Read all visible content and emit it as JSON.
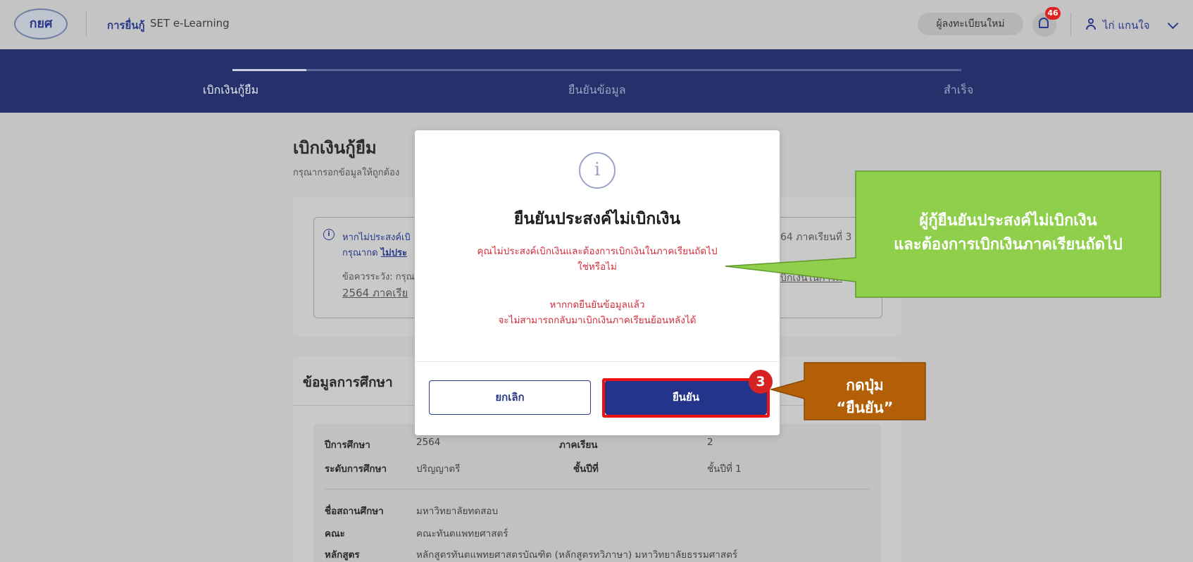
{
  "header": {
    "logo_text": "กยศ",
    "nav": [
      "การยื่นกู้",
      "SET e-Learning"
    ],
    "new_register_label": "ผู้ลงทะเบียนใหม่",
    "notification_count": "46",
    "user_name": "ไก่ แกนใจ"
  },
  "stepper": {
    "steps": [
      "เบิกเงินกู้ยืม",
      "ยืนยันข้อมูล",
      "สำเร็จ"
    ],
    "active_index": 0
  },
  "page": {
    "title": "เบิกเงินกู้ยืม",
    "subtitle": "กรุณากรอกข้อมูลให้ถูกต้อง",
    "notice": {
      "line1": "หากไม่ประสงค์เบิ",
      "line2_prefix": "กรุณากด",
      "line2_link": "ไม่ประ",
      "line3": "ข้อควรระวัง: กรุณ",
      "line4": "2564 ภาคเรีย",
      "right1": "64 ภาคเรียนที่ 3",
      "right2": "บิกเงินในการศึ"
    },
    "education": {
      "title": "ข้อมูลการศึกษา",
      "year_label": "ปีการศึกษา",
      "year_value": "2564",
      "term_label": "ภาคเรียน",
      "term_value": "2",
      "level_label": "ระดับการศึกษา",
      "level_value": "ปริญญาตรี",
      "grade_label": "ชั้นปีที่",
      "grade_value": "ชั้นปีที่ 1",
      "school_label": "ชื่อสถานศึกษา",
      "school_value": "มหาวิทยาลัยทดสอบ",
      "faculty_label": "คณะ",
      "faculty_value": "คณะทันตแพทยศาสตร์",
      "program_label": "หลักสูตร",
      "program_value": "หลักสูตรทันตแพทยศาสตรบัณฑิต (หลักสูตรทวิภาษา) มหาวิทยาลัยธรรมศาสตร์"
    }
  },
  "modal": {
    "icon": "info-icon",
    "title": "ยืนยันประสงค์ไม่เบิกเงิน",
    "question_line1": "คุณไม่ประสงค์เบิกเงินและต้องการเบิกเงินในภาคเรียนถัดไป",
    "question_line2": "ใช่หรือไม่",
    "warning_line1": "หากกดยืนยันข้อมูลแล้ว",
    "warning_line2": "จะไม่สามารถกลับมาเบิกเงินภาคเรียนย้อนหลังได้",
    "cancel_label": "ยกเลิก",
    "confirm_label": "ยืนยัน"
  },
  "annotations": {
    "step_number": "3",
    "green_line1": "ผู้กู้ยืนยันประสงค์ไม่เบิกเงิน",
    "green_line2": "และต้องการเบิกเงินภาคเรียนถัดไป",
    "orange_line1": "กดปุ่ม",
    "orange_line2": "“ยืนยัน”"
  },
  "colors": {
    "brand_navy": "#25316a",
    "confirm_button": "#23348a",
    "warning_text": "#cf2f3a",
    "highlight_border": "#e11111",
    "callout_green": "#8fcf4c",
    "callout_orange": "#b35f08"
  }
}
